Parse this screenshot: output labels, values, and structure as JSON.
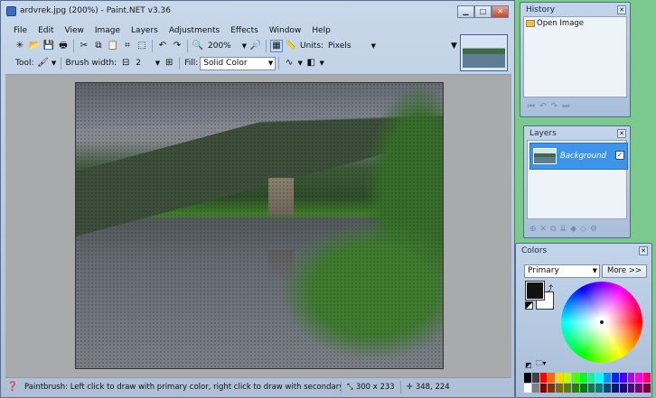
{
  "window": {
    "title": "ardvrek.jpg (200%) - Paint.NET v3.36",
    "minimize": "▁",
    "maximize": "□",
    "close": "✕"
  },
  "menu": [
    "File",
    "Edit",
    "View",
    "Image",
    "Layers",
    "Adjustments",
    "Effects",
    "Window",
    "Help"
  ],
  "toolbar": {
    "zoom_value": "200%",
    "units_label": "Units:",
    "units_value": "Pixels",
    "tool_label": "Tool:",
    "brush_width_label": "Brush width:",
    "brush_width_value": "2",
    "fill_label": "Fill:",
    "fill_value": "Solid Color"
  },
  "status": {
    "message": "Paintbrush: Left click to draw with primary color, right click to draw with secondary color",
    "image_size": "300 x 233",
    "cursor_position": "348, 224"
  },
  "history": {
    "title": "History",
    "items": [
      "Open Image"
    ]
  },
  "layers": {
    "title": "Layers",
    "items": [
      {
        "name": "Background",
        "visible": true
      }
    ]
  },
  "colors_panel": {
    "title": "Colors",
    "mode": "Primary",
    "more_button": "More >>",
    "primary_color": "#111111",
    "secondary_color": "#ffffff",
    "palette": [
      "#000000",
      "#404040",
      "#ff0000",
      "#ff6a00",
      "#ffd800",
      "#b6ff00",
      "#4cff00",
      "#00ff21",
      "#00ff90",
      "#00ffff",
      "#0094ff",
      "#0026ff",
      "#4800ff",
      "#b200ff",
      "#ff00dc",
      "#ff006e",
      "#ffffff",
      "#808080",
      "#7f0000",
      "#7f3300",
      "#7f6a00",
      "#5b7f00",
      "#267f00",
      "#007f0e",
      "#007f46",
      "#007f7f",
      "#004a7f",
      "#00137f",
      "#21007f",
      "#57007f",
      "#7f006e",
      "#7f0037"
    ]
  }
}
